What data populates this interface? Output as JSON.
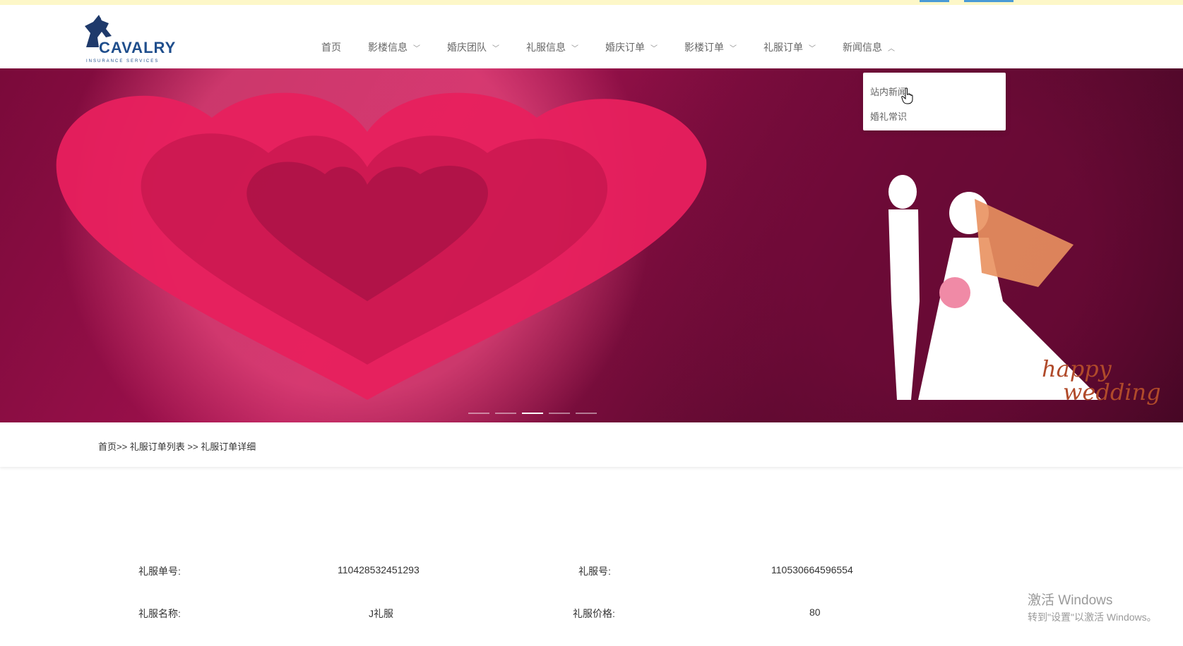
{
  "brand": {
    "name": "CAVALRY",
    "tagline": "INSURANCE SERVICES",
    "color": "#1f4e8c"
  },
  "nav": {
    "items": [
      {
        "label": "首页",
        "has_dropdown": false
      },
      {
        "label": "影楼信息",
        "has_dropdown": true
      },
      {
        "label": "婚庆团队",
        "has_dropdown": true
      },
      {
        "label": "礼服信息",
        "has_dropdown": true
      },
      {
        "label": "婚庆订单",
        "has_dropdown": true
      },
      {
        "label": "影楼订单",
        "has_dropdown": true
      },
      {
        "label": "礼服订单",
        "has_dropdown": true
      },
      {
        "label": "新闻信息",
        "has_dropdown": true,
        "expanded": true
      }
    ]
  },
  "dropdown": {
    "items": [
      "站内新闻",
      "婚礼常识"
    ]
  },
  "hero": {
    "slides": 5,
    "active_slide": 3,
    "caption_line1": "happy",
    "caption_line2": "wedding"
  },
  "breadcrumb": {
    "text": "首页>> 礼服订单列表 >> 礼服订单详细"
  },
  "detail": {
    "order_no_label": "礼服单号:",
    "order_no_value": "110428532451293",
    "gown_no_label": "礼服号:",
    "gown_no_value": "110530664596554",
    "gown_name_label": "礼服名称:",
    "gown_name_value": "J礼服",
    "gown_price_label": "礼服价格:",
    "gown_price_value": "80"
  },
  "os_watermark": {
    "line1": "激活 Windows",
    "line2": "转到\"设置\"以激活 Windows。"
  }
}
